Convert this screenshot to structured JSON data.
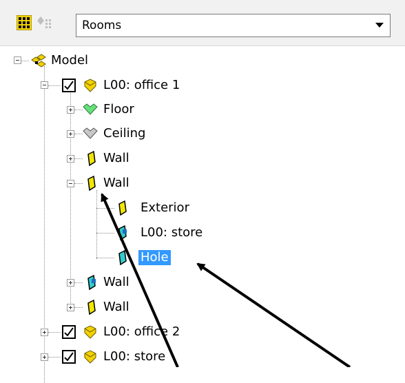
{
  "toolbar": {
    "view_selector": {
      "selected": "Rooms"
    }
  },
  "tree": {
    "root": {
      "label": "Model"
    },
    "office1": {
      "label": "L00: office 1"
    },
    "office1_children": {
      "floor": "Floor",
      "ceiling": "Ceiling",
      "wall1": "Wall",
      "wall2": "Wall",
      "wall2_children": {
        "exterior": "Exterior",
        "store": "L00: store",
        "hole": "Hole"
      },
      "wall3": "Wall",
      "wall4": "Wall"
    },
    "office2": {
      "label": "L00: office 2"
    },
    "store": {
      "label": "L00: store"
    }
  },
  "colors": {
    "selection": "#3399ff",
    "room_icon": "#f2d200",
    "wall_icon": "#f2e600",
    "floor_icon": "#66e07a",
    "ceiling_icon": "#c8c8c8",
    "hole_icon": "#33cccc"
  }
}
